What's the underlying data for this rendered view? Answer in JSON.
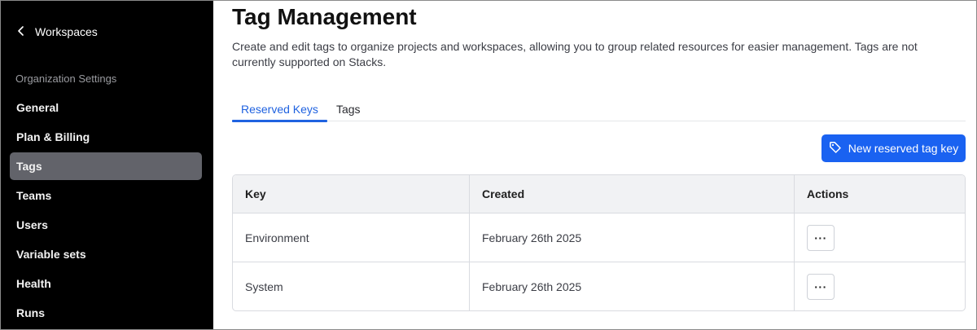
{
  "sidebar": {
    "back_label": "Workspaces",
    "section_label": "Organization Settings",
    "items": [
      {
        "label": "General"
      },
      {
        "label": "Plan & Billing"
      },
      {
        "label": "Tags",
        "active": true
      },
      {
        "label": "Teams"
      },
      {
        "label": "Users"
      },
      {
        "label": "Variable sets"
      },
      {
        "label": "Health"
      },
      {
        "label": "Runs"
      }
    ]
  },
  "main": {
    "title": "Tag Management",
    "description": "Create and edit tags to organize projects and workspaces, allowing you to group related resources for easier management. Tags are not currently supported on Stacks.",
    "tabs": [
      {
        "label": "Reserved Keys",
        "active": true
      },
      {
        "label": "Tags"
      }
    ],
    "new_button_label": "New reserved tag key",
    "table": {
      "headers": [
        "Key",
        "Created",
        "Actions"
      ],
      "rows": [
        {
          "key": "Environment",
          "created": "February 26th 2025",
          "action": "···"
        },
        {
          "key": "System",
          "created": "February 26th 2025",
          "action": "···"
        }
      ]
    }
  },
  "icons": {
    "back": "chevron-left-icon",
    "new_button": "tag-icon",
    "row_action": "more-horizontal-icon"
  },
  "colors": {
    "sidebar_bg": "#000000",
    "sidebar_active": "#62636a",
    "accent": "#1a62f1",
    "tab_active": "#1f62e0"
  }
}
